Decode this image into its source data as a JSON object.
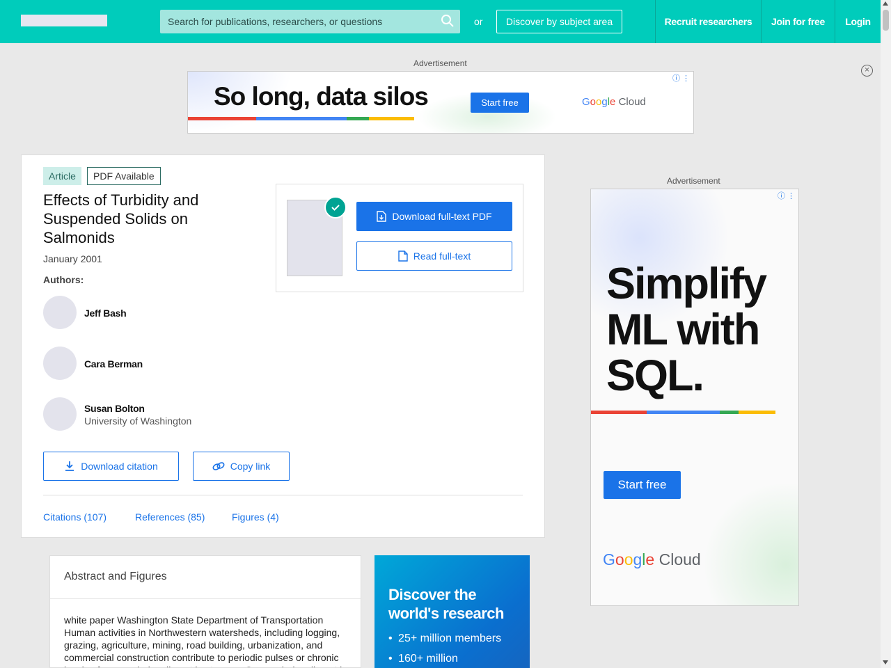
{
  "header": {
    "search_placeholder": "Search for publications, researchers, or questions",
    "or_text": "or",
    "discover_label": "Discover by subject area",
    "recruit_label": "Recruit researchers",
    "join_label": "Join for free",
    "login_label": "Login",
    "brand_color": "#00ccbb"
  },
  "ads": {
    "label": "Advertisement",
    "top": {
      "headline": "So long, data silos",
      "cta": "Start free",
      "brand_google": [
        "G",
        "o",
        "o",
        "g",
        "l",
        "e"
      ],
      "brand_cloud": "Cloud"
    },
    "side": {
      "headline_lines": [
        "Simplify",
        "ML with",
        "SQL."
      ],
      "cta": "Start free",
      "brand_cloud": "Cloud"
    },
    "accent_colors": [
      "#ea4335",
      "#4285f4",
      "#34a853",
      "#fbbc05"
    ]
  },
  "article": {
    "type_badge": "Article",
    "pdf_badge": "PDF Available",
    "title": "Effects of Turbidity and Suspended Solids on Salmonids",
    "date": "January 2001",
    "authors_label": "Authors:",
    "authors": [
      {
        "name": "Jeff Bash",
        "affiliation": ""
      },
      {
        "name": "Cara Berman",
        "affiliation": ""
      },
      {
        "name": "Susan Bolton",
        "affiliation": "University of Washington"
      }
    ],
    "download_pdf_label": "Download full-text PDF",
    "read_fulltext_label": "Read full-text",
    "download_citation_label": "Download citation",
    "copy_link_label": "Copy link",
    "tabs": [
      "Citations (107)",
      "References (85)",
      "Figures (4)"
    ]
  },
  "abstract": {
    "heading": "Abstract and Figures",
    "text": "white paper Washington State Department of Transportation Human activities in Northwestern watersheds, including logging, grazing, agriculture, mining, road building, urbanization, and commercial construction contribute to periodic pulses or chronic levels of suspended sediment in streams. Suspended sediment is"
  },
  "promo": {
    "heading": "Discover the world's research",
    "bullets": [
      "25+ million members",
      "160+ million"
    ]
  }
}
